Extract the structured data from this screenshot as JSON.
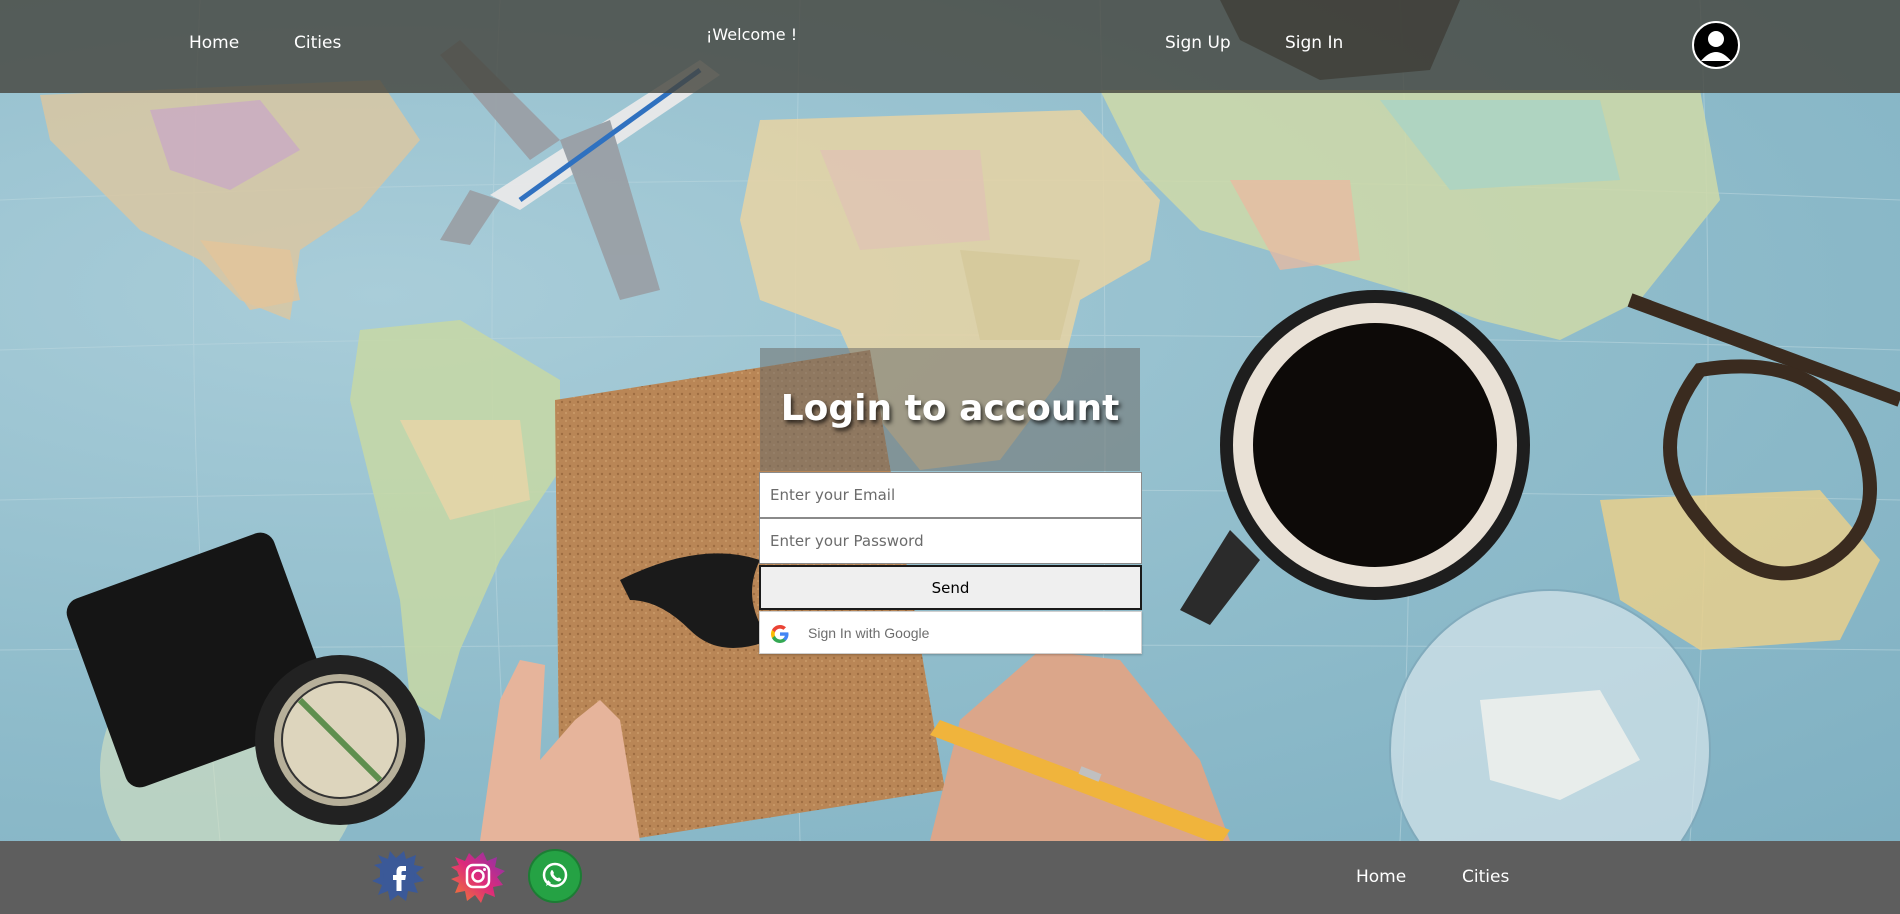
{
  "header": {
    "nav_left": [
      "Home",
      "Cities"
    ],
    "welcome": "¡Welcome !",
    "nav_right": [
      "Sign Up",
      "Sign In"
    ],
    "avatar_icon": "user-circle-icon"
  },
  "login": {
    "title": "Login to account",
    "email_placeholder": "Enter your Email",
    "password_placeholder": "Enter your Password",
    "send_label": "Send",
    "google_label": "Sign In with Google",
    "google_icon": "google-g-icon"
  },
  "footer": {
    "social_icons": [
      "facebook-icon",
      "instagram-icon",
      "whatsapp-icon"
    ],
    "links": [
      "Home",
      "Cities"
    ]
  },
  "colors": {
    "header_bg": "#46463e",
    "footer_bg": "#5e5e5e",
    "facebook": "#3b5998",
    "whatsapp": "#25a244",
    "text": "#ffffff"
  }
}
